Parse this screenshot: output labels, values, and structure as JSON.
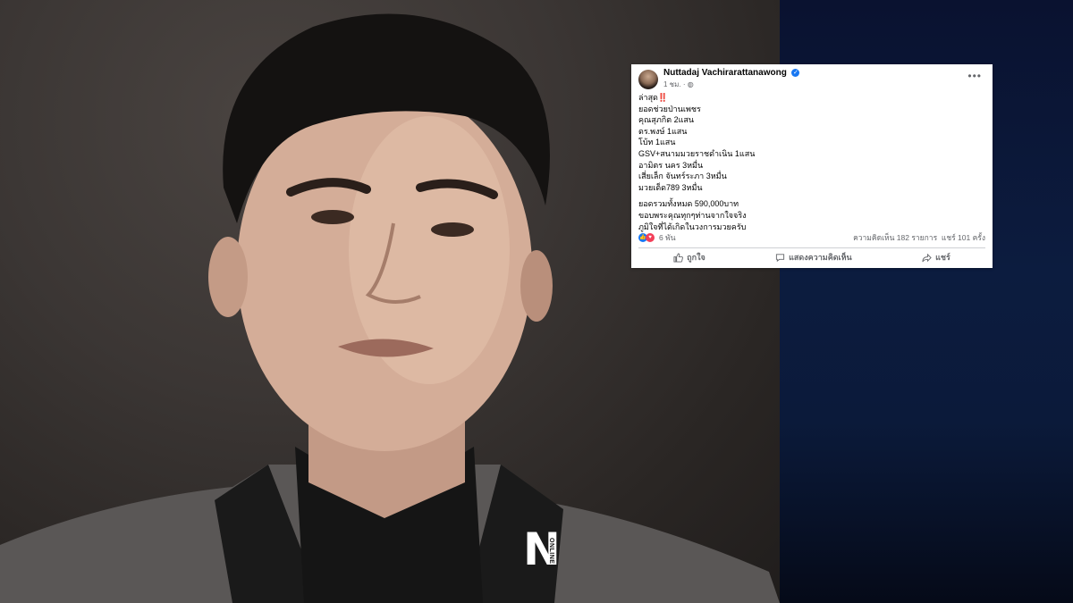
{
  "post": {
    "author": "Nuttadaj Vachirarattanawong",
    "verified_icon": "verified-badge-icon",
    "time": "1 ชม.",
    "privacy_icon": "globe-icon",
    "menu_icon": "more-dots-icon",
    "lines": [
      "ล่าสุด",
      "ยอดช่วยป่านเพชร",
      "คุณสุภกิต 2แสน",
      "ดร.พงษ์ 1แสน",
      "โบ้ท 1แสน",
      "GSV+สนามมวยราชดำเนิน 1แสน",
      "อามิตร นคร 3หมื่น",
      "เสี่ยเล็ก จันทร์ระภา 3หมื่น",
      "มวยเด็ด789 3หมื่น",
      "ยอดรวมทั้งหมด 590,000บาท",
      "ขอบพระคุณทุกๆท่านจากใจจริง",
      "ภูมิใจที่ได้เกิดในวงการมวยครับ"
    ],
    "headline_emoji": "‼️",
    "reactions_count": "6 พัน",
    "comments_text": "ความคิดเห็น 182 รายการ",
    "shares_text": "แชร์ 101 ครั้ง",
    "actions": {
      "like": "ถูกใจ",
      "comment": "แสดงความคิดเห็น",
      "share": "แชร์"
    }
  },
  "logo": {
    "letter": "N",
    "sub": "ONLINE"
  },
  "colors": {
    "facebook_blue": "#1877f2",
    "love_red": "#f33e58",
    "background_navy": "#0b1630"
  }
}
